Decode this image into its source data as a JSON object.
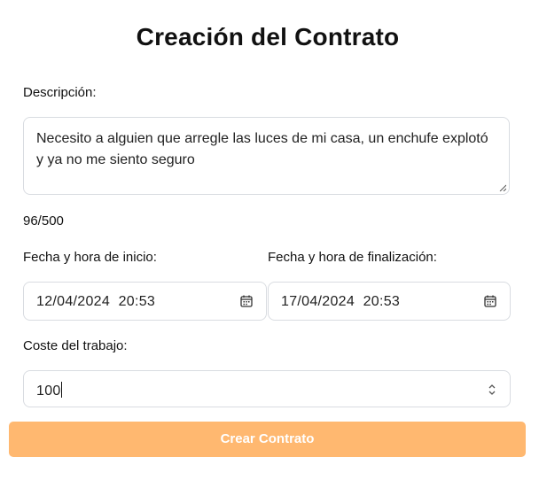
{
  "page": {
    "title": "Creación del Contrato"
  },
  "form": {
    "description_label": "Descripción:",
    "description_value": "Necesito a alguien que arregle las luces de mi casa, un enchufe explotó y ya no me siento seguro",
    "char_counter": "96/500",
    "start_label": "Fecha y hora de inicio:",
    "start_value": "12/04/2024  20:53",
    "end_label": "Fecha y hora de finalización:",
    "end_value": "17/04/2024  20:53",
    "cost_label": "Coste del trabajo:",
    "cost_value": "100",
    "submit_label": "Crear Contrato"
  },
  "colors": {
    "submit_bg": "#ffb870",
    "border": "#d9dce1"
  },
  "icons": [
    "calendar-icon",
    "number-spinner-icon",
    "resize-grip-icon"
  ]
}
